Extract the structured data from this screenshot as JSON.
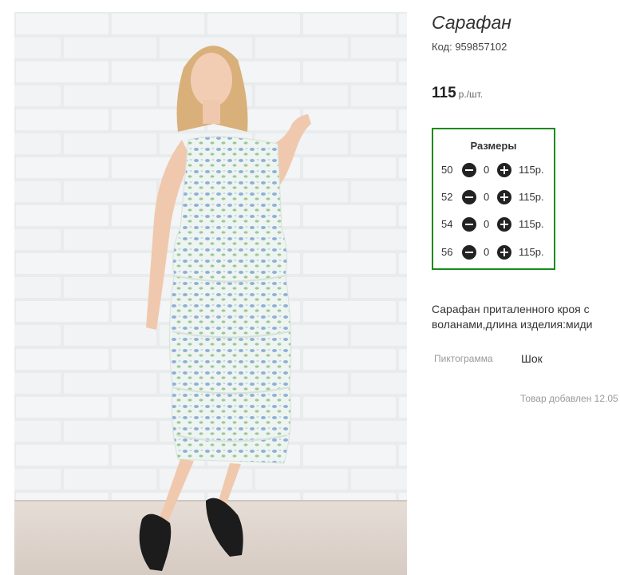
{
  "product": {
    "title": "Сарафан",
    "code": "Код: 959857102",
    "price": "115",
    "price_unit": "р./шт."
  },
  "sizes": {
    "heading": "Размеры",
    "rows": [
      {
        "size": "50",
        "qty": "0",
        "price": "115р."
      },
      {
        "size": "52",
        "qty": "0",
        "price": "115р."
      },
      {
        "size": "54",
        "qty": "0",
        "price": "115р."
      },
      {
        "size": "56",
        "qty": "0",
        "price": "115р."
      }
    ]
  },
  "description": "Сарафан приталенного кроя с воланами,длина изделия:миди",
  "attributes": {
    "label": "Пиктограмма",
    "value": "Шок"
  },
  "added_text": "Товар добавлен 12.05",
  "colors": {
    "sizes_border": "#1a8a1a",
    "cart_button": "#b8d832"
  }
}
